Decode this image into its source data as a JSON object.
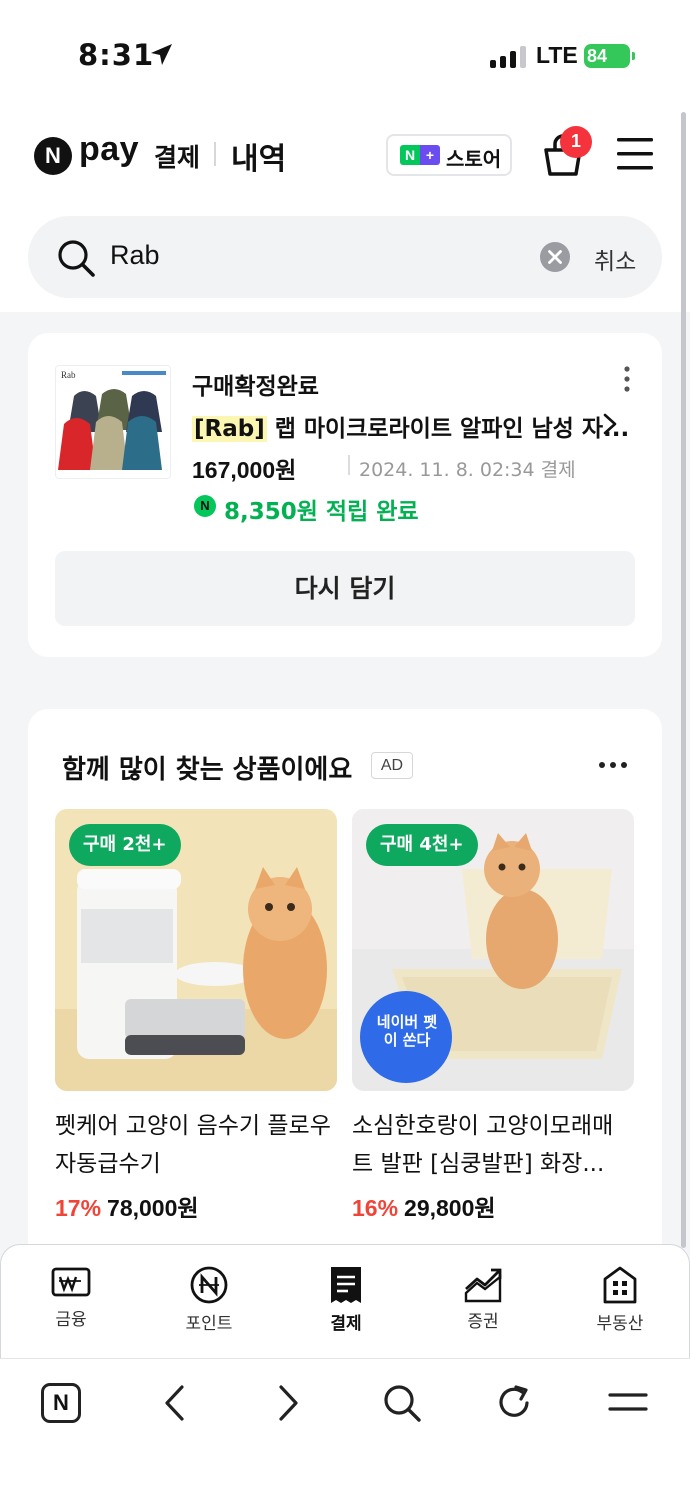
{
  "status_bar": {
    "time": "8:31",
    "network": "LTE",
    "battery": "84"
  },
  "header": {
    "logo_n": "N",
    "logo_pay": "pay",
    "logo_label": "결제",
    "title": "내역",
    "store_badge_n": "N",
    "store_badge_plus": "+",
    "store_label": "스토어",
    "cart_count": "1"
  },
  "search": {
    "query": "Rab",
    "cancel_label": "취소"
  },
  "order": {
    "status": "구매확정완료",
    "title_highlight": "[Rab]",
    "title_rest": " 랩 마이크로라이트 알파인 남성 자...",
    "price": "167,000원",
    "date": "2024. 11. 8. 02:34 결제",
    "point_icon": "N",
    "points": "8,350원 적립 완료",
    "recart_label": "다시 담기",
    "thumb_brand": "Rab"
  },
  "recommend": {
    "title": "함께 많이 찾는 상품이에요",
    "ad_label": "AD",
    "products": [
      {
        "badge": "구매 2천+",
        "name": "펫케어 고양이 음수기 플로우 자동급수기",
        "discount": "17%",
        "price": "78,000원"
      },
      {
        "badge": "구매 4천+",
        "name": "소심한호랑이 고양이모래매트 발판 [심쿵발판] 화장...",
        "discount": "16%",
        "price": "29,800원",
        "sticker": "네이버 펫이 쏜다"
      }
    ]
  },
  "tabs": [
    {
      "label": "금융",
      "icon": "finance-icon",
      "active": false
    },
    {
      "label": "포인트",
      "icon": "point-icon",
      "active": false
    },
    {
      "label": "결제",
      "icon": "payment-receipt-icon",
      "active": true
    },
    {
      "label": "증권",
      "icon": "stock-chart-icon",
      "active": false
    },
    {
      "label": "부동산",
      "icon": "building-icon",
      "active": false
    }
  ],
  "browser": {
    "home_label": "N"
  },
  "colors": {
    "naver_green": "#03c75a",
    "point_green": "#03b153",
    "discount_red": "#f04438",
    "badge_red": "#f4333c",
    "badge_green": "#0fa85f"
  }
}
